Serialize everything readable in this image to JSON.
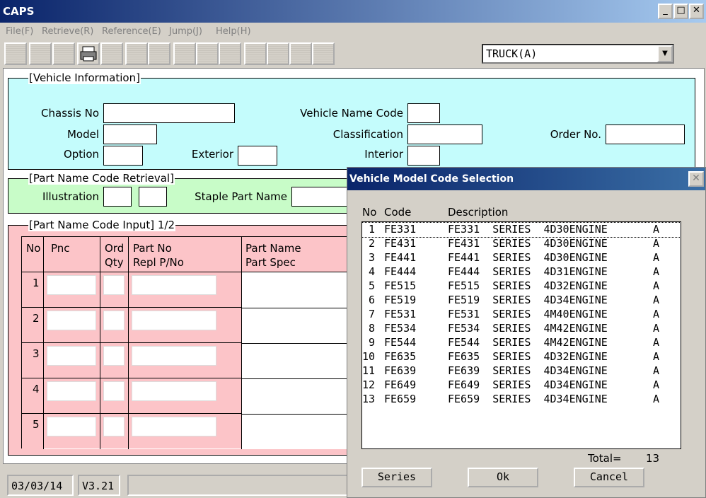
{
  "app": {
    "title": "CAPS"
  },
  "window_buttons": {
    "minimize": "_",
    "maximize": "□",
    "close": "✕"
  },
  "menu": [
    "File(F)",
    "Retrieve(R)",
    "Reference(E)",
    "Jump(J)",
    "Help(H)"
  ],
  "vehicle_type": {
    "selected": "TRUCK(A)"
  },
  "vehicle_info": {
    "title": "[Vehicle Information]",
    "chassis_no": "Chassis No",
    "vehicle_name_code": "Vehicle Name Code",
    "model": "Model",
    "classification": "Classification",
    "order_no": "Order No.",
    "option": "Option",
    "exterior": "Exterior",
    "interior": "Interior"
  },
  "pnc_retrieval": {
    "title": "[Part Name Code Retrieval]",
    "illustration": "Illustration",
    "staple_part_name": "Staple Part Name"
  },
  "pnc_input": {
    "title": "[Part Name Code Input] 1/2",
    "headers": {
      "no": "No",
      "pnc": "Pnc",
      "ord": "Ord",
      "qty": "Qty",
      "part_no": "Part No",
      "repl": "Repl P/No",
      "part_name": "Part Name",
      "part_spec": "Part Spec"
    },
    "rows": [
      "1",
      "2",
      "3",
      "4",
      "5"
    ]
  },
  "status": {
    "date": "03/03/14",
    "version": "V3.21"
  },
  "colors": {
    "vehicle_info_bg": "#c4fcfc",
    "retrieval_bg": "#c8fcc8",
    "input_bg": "#fcc4c8",
    "table_header_bg": "#fcc4c8"
  },
  "dialog": {
    "title": "Vehicle Model Code Selection",
    "close": "✕",
    "col_no": "No",
    "col_code": "Code",
    "col_desc": "Description",
    "items": [
      {
        "no": "1",
        "code": "FE331",
        "desc": "FE331  SERIES  4D30ENGINE",
        "flag": "A"
      },
      {
        "no": "2",
        "code": "FE431",
        "desc": "FE431  SERIES  4D30ENGINE",
        "flag": "A"
      },
      {
        "no": "3",
        "code": "FE441",
        "desc": "FE441  SERIES  4D30ENGINE",
        "flag": "A"
      },
      {
        "no": "4",
        "code": "FE444",
        "desc": "FE444  SERIES  4D31ENGINE",
        "flag": "A"
      },
      {
        "no": "5",
        "code": "FE515",
        "desc": "FE515  SERIES  4D32ENGINE",
        "flag": "A"
      },
      {
        "no": "6",
        "code": "FE519",
        "desc": "FE519  SERIES  4D34ENGINE",
        "flag": "A"
      },
      {
        "no": "7",
        "code": "FE531",
        "desc": "FE531  SERIES  4M40ENGINE",
        "flag": "A"
      },
      {
        "no": "8",
        "code": "FE534",
        "desc": "FE534  SERIES  4M42ENGINE",
        "flag": "A"
      },
      {
        "no": "9",
        "code": "FE544",
        "desc": "FE544  SERIES  4M42ENGINE",
        "flag": "A"
      },
      {
        "no": "10",
        "code": "FE635",
        "desc": "FE635  SERIES  4D32ENGINE",
        "flag": "A"
      },
      {
        "no": "11",
        "code": "FE639",
        "desc": "FE639  SERIES  4D34ENGINE",
        "flag": "A"
      },
      {
        "no": "12",
        "code": "FE649",
        "desc": "FE649  SERIES  4D34ENGINE",
        "flag": "A"
      },
      {
        "no": "13",
        "code": "FE659",
        "desc": "FE659  SERIES  4D34ENGINE",
        "flag": "A"
      }
    ],
    "total_label": "Total=",
    "total_value": "13",
    "buttons": {
      "series": "Series",
      "ok": "Ok",
      "cancel": "Cancel"
    }
  }
}
